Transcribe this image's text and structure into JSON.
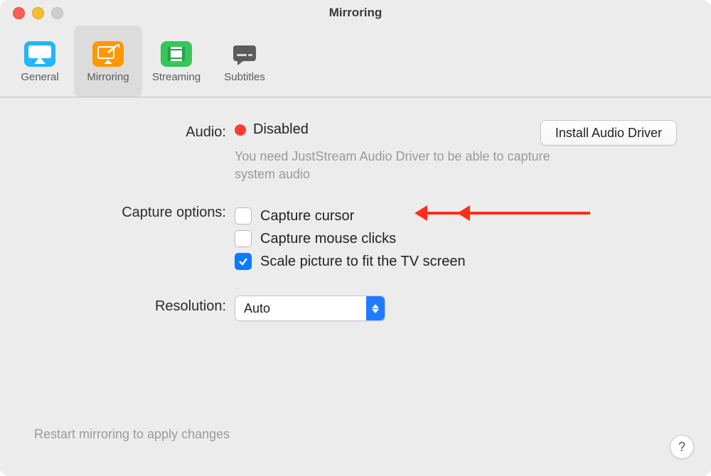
{
  "window": {
    "title": "Mirroring"
  },
  "tabs": [
    {
      "label": "General",
      "icon": "airplay-icon",
      "selected": false,
      "color": "#2aa9ff"
    },
    {
      "label": "Mirroring",
      "icon": "mirroring-icon",
      "selected": true,
      "color": "#ff9400"
    },
    {
      "label": "Streaming",
      "icon": "streaming-icon",
      "selected": false,
      "color": "#34c759"
    },
    {
      "label": "Subtitles",
      "icon": "subtitles-icon",
      "selected": false,
      "color": "#5a5a5a"
    }
  ],
  "audio": {
    "label": "Audio:",
    "status_text": "Disabled",
    "status_color": "#ff3b30",
    "install_button": "Install Audio Driver",
    "hint": "You need JustStream Audio Driver to be able to capture system audio"
  },
  "capture": {
    "label": "Capture options:",
    "items": [
      {
        "text": "Capture cursor",
        "checked": false,
        "arrow": true
      },
      {
        "text": "Capture mouse clicks",
        "checked": false,
        "arrow": true
      },
      {
        "text": "Scale picture to fit the TV screen",
        "checked": true,
        "arrow": false
      }
    ]
  },
  "resolution": {
    "label": "Resolution:",
    "value": "Auto"
  },
  "footer": "Restart mirroring to apply changes",
  "help": "?"
}
